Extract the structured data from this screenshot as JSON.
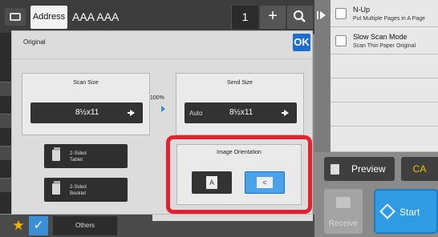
{
  "topbar": {
    "address_tab_label": "Address",
    "address_value": "AAA AAA",
    "count_value": "1",
    "plus_label": "+"
  },
  "side_panel": {
    "items": [
      {
        "title": "N-Up",
        "subtitle": "Put Multiple Pages in A Page"
      },
      {
        "title": "Slow Scan Mode",
        "subtitle": "Scan Thin Paper Original"
      }
    ]
  },
  "actions": {
    "preview_label": "Preview",
    "ca_label": "CA",
    "receive_label": "Receive",
    "start_label": "Start"
  },
  "bottom_bar": {
    "star_glyph": "★",
    "check_glyph": "✓",
    "others_label": "Others"
  },
  "dialog": {
    "title": "Original",
    "ok_label": "OK",
    "scan_size": {
      "label": "Scan Size",
      "value": "8½x11"
    },
    "ratio": "100%",
    "send_size": {
      "label": "Send Size",
      "mode": "Auto",
      "value": "8½x11"
    },
    "tablet_label": "2-Sided\nTablet",
    "booklet_label": "2-Sided\nBooklet",
    "orientation": {
      "title": "Image Orientation",
      "portrait_glyph": "A",
      "landscape_glyph": "<",
      "selected": "landscape"
    }
  },
  "colors": {
    "accent_blue": "#2f9be3",
    "highlight_red": "#e5212f",
    "ca_yellow": "#f5c400",
    "ok_blue": "#1d6ed0"
  }
}
